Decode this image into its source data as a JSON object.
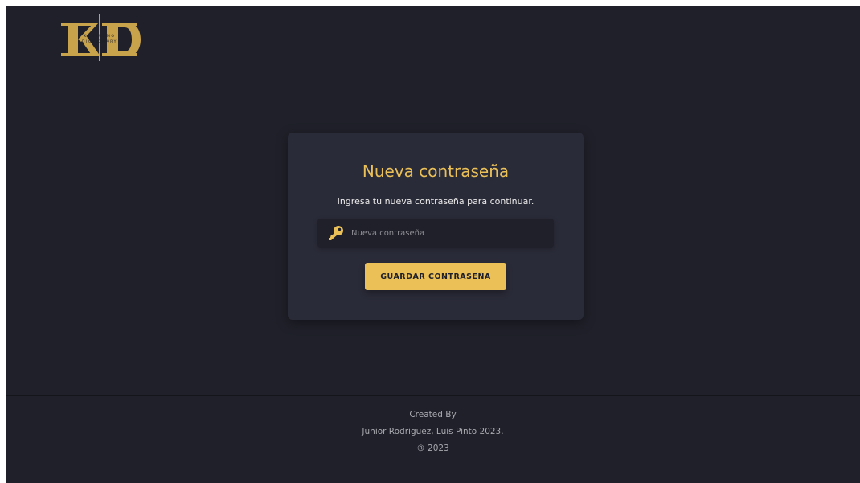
{
  "header": {
    "logo": {
      "letters": "KD",
      "top_text": "KANKUAMO",
      "bottom_text": "DICTIONARY",
      "color": "#c9a24c"
    }
  },
  "reset_card": {
    "title": "Nueva contraseña",
    "subtitle": "Ingresa tu nueva contraseña para continuar.",
    "password_field": {
      "icon": "key-icon",
      "placeholder": "Nueva contraseña",
      "value": ""
    },
    "submit_label": "GUARDAR CONTRASEÑA"
  },
  "footer": {
    "line1": "Created By",
    "line2": "Junior Rodriguez, Luis Pinto 2023.",
    "line3": "® 2023"
  },
  "colors": {
    "background": "#1f2029",
    "card": "#2a2b38",
    "accent": "#ebc157",
    "text": "#ececec"
  }
}
